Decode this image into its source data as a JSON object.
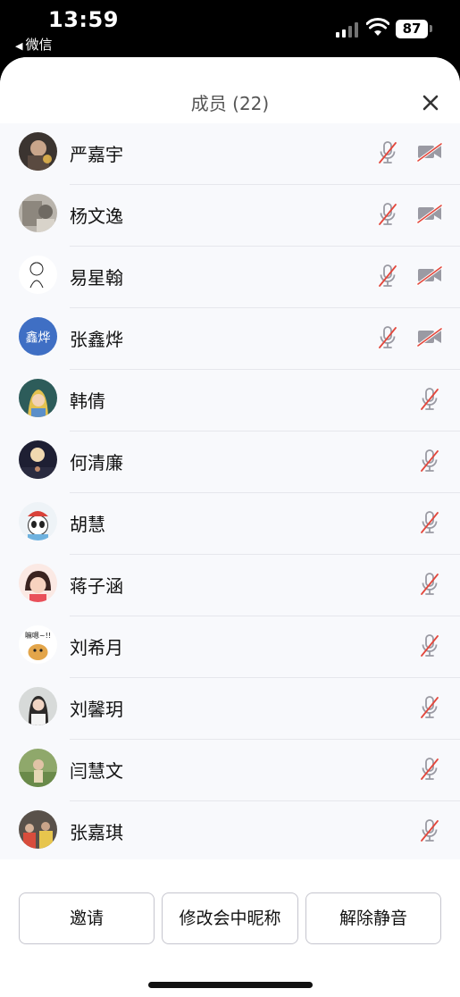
{
  "status_bar": {
    "time": "13:59",
    "back_app": "微信",
    "battery": "87"
  },
  "sheet": {
    "title": "成员 (22)"
  },
  "members": [
    {
      "name": "严嘉宇",
      "mic_muted": true,
      "camera_off": true,
      "avatar": "photo-fireworks"
    },
    {
      "name": "杨文逸",
      "mic_muted": true,
      "camera_off": true,
      "avatar": "photo-gray"
    },
    {
      "name": "易星翰",
      "mic_muted": true,
      "camera_off": true,
      "avatar": "line-drawing"
    },
    {
      "name": "张鑫烨",
      "mic_muted": true,
      "camera_off": true,
      "avatar": "initials",
      "avatar_text": "鑫烨",
      "avatar_color": "#3f6fc4"
    },
    {
      "name": "韩倩",
      "mic_muted": true,
      "camera_off": false,
      "avatar": "cartoon-girl"
    },
    {
      "name": "何清廉",
      "mic_muted": true,
      "camera_off": false,
      "avatar": "night-moon"
    },
    {
      "name": "胡慧",
      "mic_muted": true,
      "camera_off": false,
      "avatar": "panda"
    },
    {
      "name": "蒋子涵",
      "mic_muted": true,
      "camera_off": false,
      "avatar": "cartoon-kid"
    },
    {
      "name": "刘希月",
      "mic_muted": true,
      "camera_off": false,
      "avatar": "meme",
      "avatar_text": "嘛嗯~!!"
    },
    {
      "name": "刘馨玥",
      "mic_muted": true,
      "camera_off": false,
      "avatar": "photo-girl"
    },
    {
      "name": "闫慧文",
      "mic_muted": true,
      "camera_off": false,
      "avatar": "photo-outdoor"
    },
    {
      "name": "张嘉琪",
      "mic_muted": true,
      "camera_off": false,
      "avatar": "photo-group"
    }
  ],
  "actions": {
    "invite": "邀请",
    "rename": "修改会中昵称",
    "unmute": "解除静音"
  },
  "colors": {
    "muted_slash": "#e3473c",
    "icon_gray": "#9a9aa3"
  }
}
